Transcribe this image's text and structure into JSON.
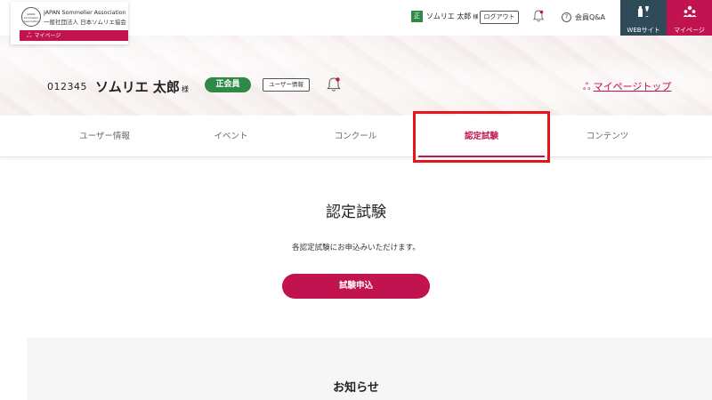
{
  "logo": {
    "emblem_text": "JAPAN Sommelier Association",
    "english_name": "JAPAN Sommelier Association",
    "japanese_name": "一般社団法人 日本ソムリエ協会",
    "mypage_label": "マイページ"
  },
  "header": {
    "member_badge": "正",
    "user_name": "ソムリエ 太郎",
    "honorific": "様",
    "logout_label": "ログアウト",
    "qa_label": "会員Q&A",
    "web_site_label": "WEBサイト",
    "my_page_label": "マイページ"
  },
  "profile": {
    "member_number": "012345",
    "name": "ソムリエ 太郎",
    "honorific": "様",
    "membership_badge": "正会員",
    "user_info_button": "ユーザー情報",
    "mypage_top_link": "マイページトップ"
  },
  "tabs": [
    {
      "label": "ユーザー情報",
      "active": false
    },
    {
      "label": "イベント",
      "active": false
    },
    {
      "label": "コンクール",
      "active": false
    },
    {
      "label": "認定試験",
      "active": true
    },
    {
      "label": "コンテンツ",
      "active": false
    }
  ],
  "main": {
    "title": "認定試験",
    "description": "各認定試験にお申込みいただけます。",
    "apply_button": "試験申込"
  },
  "notice": {
    "title": "お知らせ"
  },
  "colors": {
    "accent": "#c0134f",
    "member_green": "#2e8b45",
    "website_button": "#2f4b5a",
    "highlight": "#e8141b"
  }
}
